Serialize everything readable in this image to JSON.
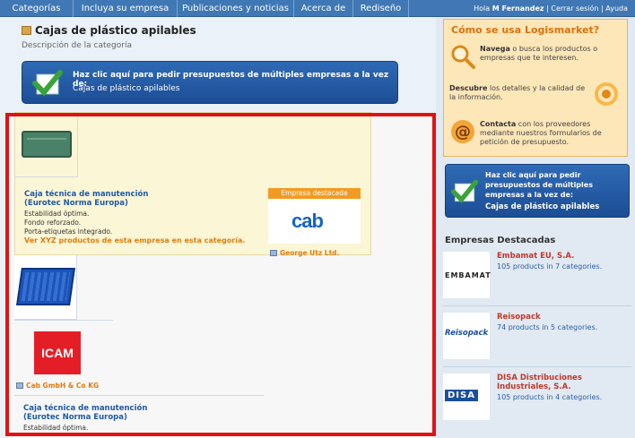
{
  "nav": {
    "tabs": [
      "Categorías",
      "Incluya su empresa",
      "Publicaciones y noticias",
      "Acerca de",
      "Rediseño"
    ],
    "user_greeting": "Hola",
    "user_name": "M Fernandez",
    "logout": "Cerrar sesión",
    "help": "Ayuda"
  },
  "page": {
    "title": "Cajas de plástico apilables",
    "description": "Descripción de la categoría"
  },
  "cta_main": {
    "line1": "Haz clic aquí para pedir presupuestos de múltiples empresas a la vez de:",
    "line2": "Cajas de plástico apilables"
  },
  "listing": {
    "item1": {
      "title_line1": "Caja técnica de manutención",
      "title_line2": "(Eurotec Norma Europa)",
      "features": [
        "Estabilidad óptima.",
        "Fondo reforzado.",
        "Porta-etiquetas integrado."
      ],
      "more_link": "Ver XYZ productos de esta empresa en esta categoría.",
      "featured_label": "Empresa destacada",
      "brand_logo_text": "cab",
      "company": "George Utz Ltd."
    },
    "item2": {
      "logo_text": "ICAM",
      "company": "Cab GmbH & Co KG",
      "title_line1": "Caja técnica de manutención",
      "title_line2": "(Eurotec Norma Europa)",
      "features": [
        "Estabilidad óptima."
      ]
    }
  },
  "sidebar": {
    "howto": {
      "title": "Cómo se usa Logismarket?",
      "steps": [
        {
          "bold": "Navega",
          "text": " o busca los productos o empresas que te interesen."
        },
        {
          "bold": "Descubre",
          "text": " los detalles y la calidad de la información."
        },
        {
          "bold": "Contacta",
          "text": " con los proveedores mediante nuestros formularios de petición de presupuesto."
        }
      ]
    },
    "cta": {
      "text": "Haz clic aquí para pedir presupuestos de múltiples empresas a la vez de:",
      "category": "Cajas de plástico apilables"
    },
    "featured_heading": "Empresas Destacadas",
    "companies": [
      {
        "logo": "EMBAMAT",
        "name": "Embamat EU, S.A.",
        "count": "105 products in 7 categories."
      },
      {
        "logo": "Reisopack",
        "name": "Reisopack",
        "count": "74 products in 5 categories."
      },
      {
        "logo": "DISA",
        "name": "DISA Distribuciones Industriales, S.A.",
        "count": "105 products in 4 categories."
      }
    ]
  },
  "colors": {
    "nav_bg": "#3f78b4",
    "accent_orange": "#e27b0c",
    "link_blue": "#1f5aa6",
    "highlight_frame": "#e01212"
  }
}
